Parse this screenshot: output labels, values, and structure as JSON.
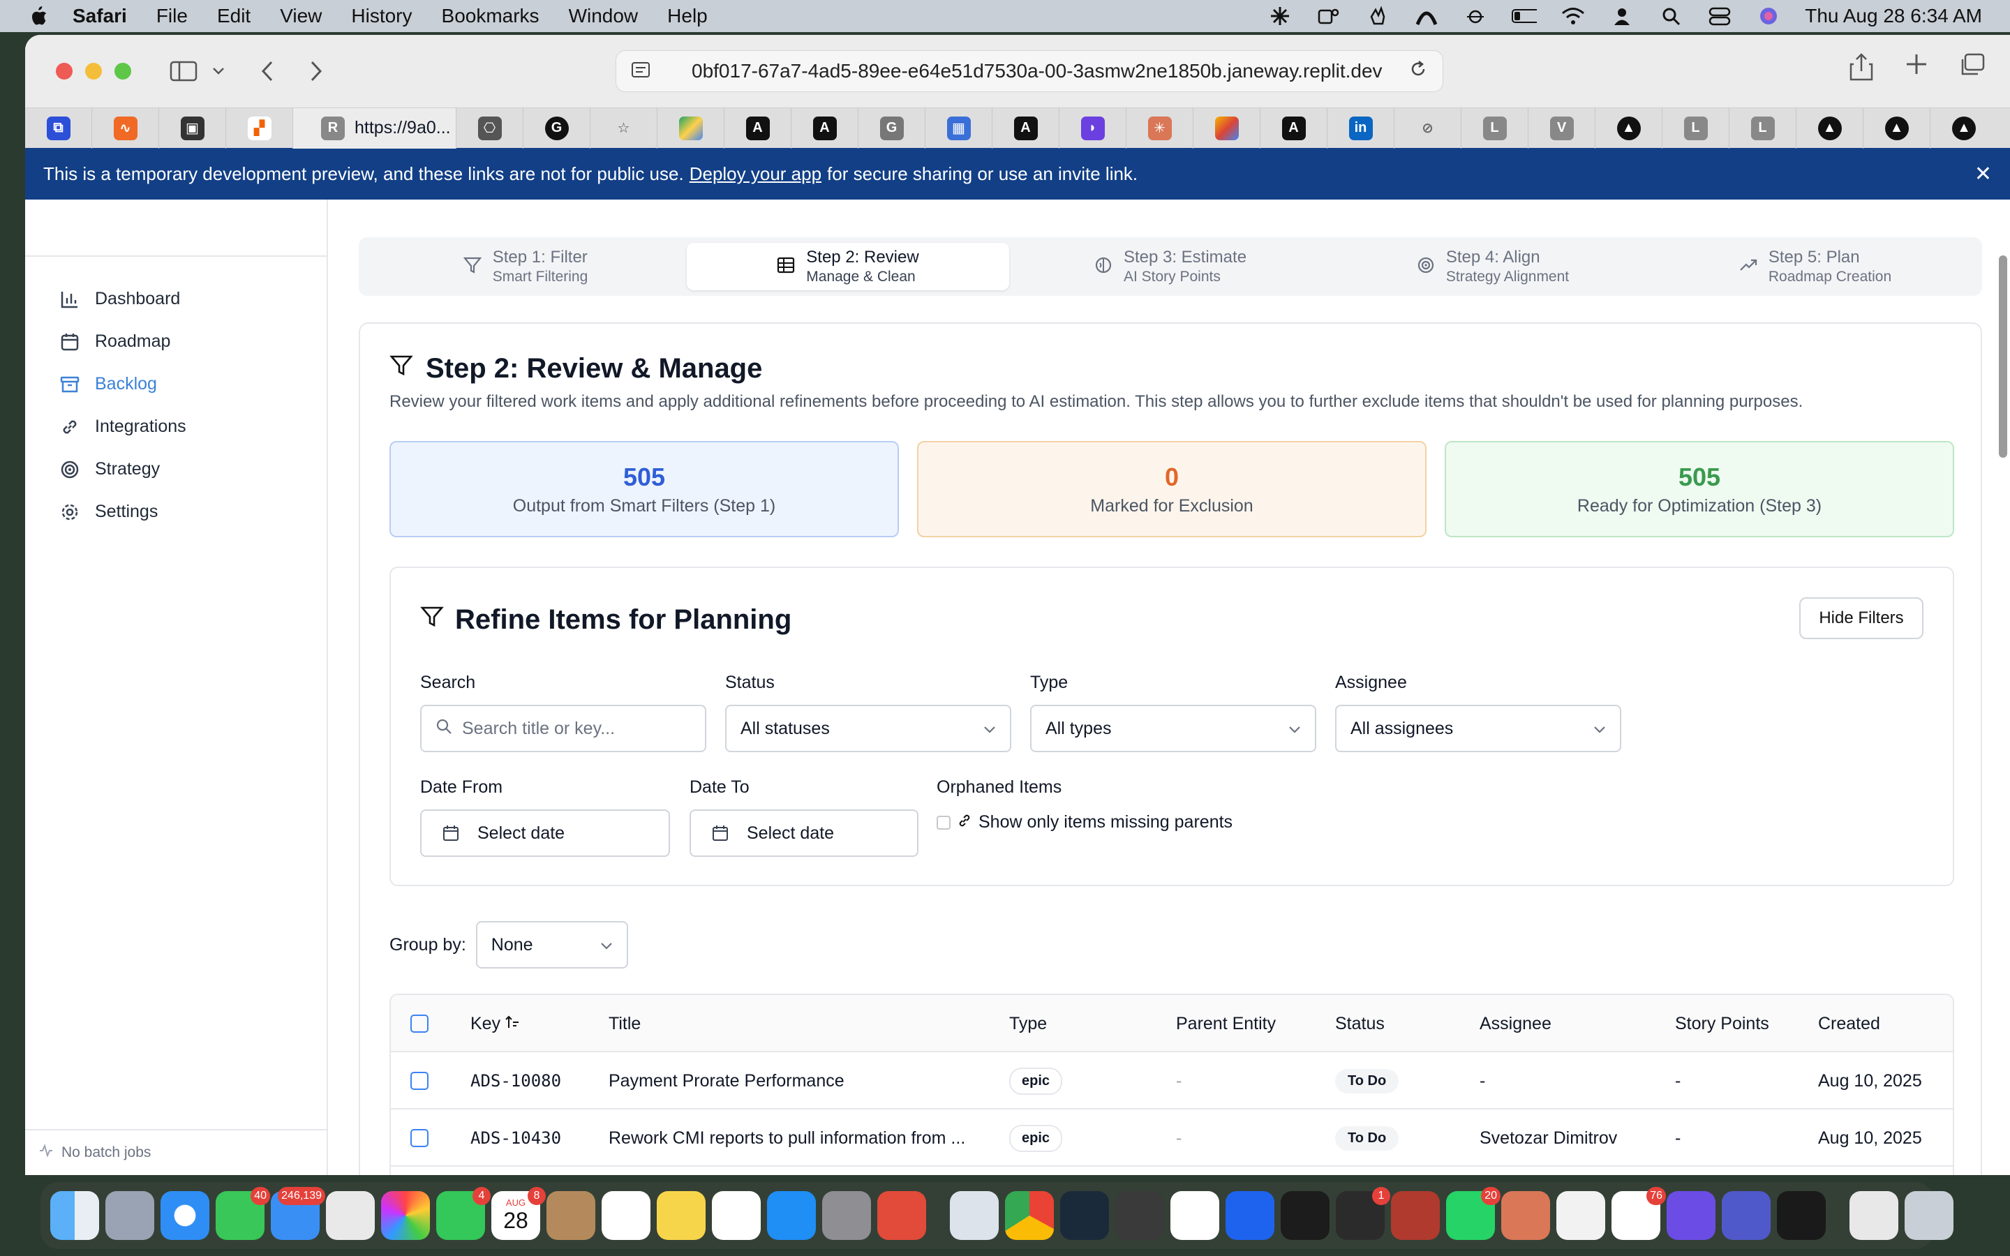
{
  "menubar": {
    "app": "Safari",
    "items": [
      "File",
      "Edit",
      "View",
      "History",
      "Bookmarks",
      "Window",
      "Help"
    ],
    "clock": "Thu Aug 28  6:34 AM"
  },
  "browser": {
    "url": "0bf017-67a7-4ad5-89ee-e64e51d7530a-00-3asmw2ne1850b.janeway.replit.dev",
    "active_tab": "https://9a0...",
    "active_tab_letter": "R"
  },
  "banner": {
    "text_before": "This is a temporary development preview, and these links are not for public use.",
    "link": "Deploy your app",
    "text_after": "for secure sharing or use an invite link."
  },
  "sidebar": {
    "items": [
      {
        "label": "Dashboard",
        "icon": "bar-chart-icon"
      },
      {
        "label": "Roadmap",
        "icon": "calendar-icon"
      },
      {
        "label": "Backlog",
        "icon": "archive-icon"
      },
      {
        "label": "Integrations",
        "icon": "link-icon"
      },
      {
        "label": "Strategy",
        "icon": "target-icon"
      },
      {
        "label": "Settings",
        "icon": "gear-icon"
      }
    ],
    "active": "Backlog",
    "footer": "No batch jobs"
  },
  "steps": [
    {
      "title": "Step 1: Filter",
      "sub": "Smart Filtering",
      "icon": "filter-icon"
    },
    {
      "title": "Step 2: Review",
      "sub": "Manage & Clean",
      "icon": "table-icon"
    },
    {
      "title": "Step 3: Estimate",
      "sub": "AI Story Points",
      "icon": "brain-icon"
    },
    {
      "title": "Step 4: Align",
      "sub": "Strategy Alignment",
      "icon": "target-icon"
    },
    {
      "title": "Step 5: Plan",
      "sub": "Roadmap Creation",
      "icon": "trend-icon"
    }
  ],
  "review": {
    "title": "Step 2: Review & Manage",
    "description": "Review your filtered work items and apply additional refinements before proceeding to AI estimation. This step allows you to further exclude items that shouldn't be used for planning purposes.",
    "stats": [
      {
        "value": "505",
        "label": "Output from Smart Filters (Step 1)",
        "color": "#2f5fd6"
      },
      {
        "value": "0",
        "label": "Marked for Exclusion",
        "color": "#e0682b"
      },
      {
        "value": "505",
        "label": "Ready for Optimization (Step 3)",
        "color": "#3a9a4e"
      }
    ]
  },
  "refine": {
    "title": "Refine Items for Planning",
    "hide_button": "Hide Filters",
    "search_label": "Search",
    "search_placeholder": "Search title or key...",
    "status_label": "Status",
    "status_value": "All statuses",
    "type_label": "Type",
    "type_value": "All types",
    "assignee_label": "Assignee",
    "assignee_value": "All assignees",
    "date_from_label": "Date From",
    "date_from_value": "Select date",
    "date_to_label": "Date To",
    "date_to_value": "Select date",
    "orphaned_label": "Orphaned Items",
    "orphaned_option": "Show only items missing parents"
  },
  "groupby": {
    "label": "Group by:",
    "value": "None"
  },
  "table": {
    "columns": [
      "Key",
      "Title",
      "Type",
      "Parent Entity",
      "Status",
      "Assignee",
      "Story Points",
      "Created"
    ],
    "rows": [
      {
        "key": "ADS-10080",
        "title": "Payment Prorate Performance",
        "type": "epic",
        "parent": "-",
        "status": "To Do",
        "assignee": "-",
        "points": "-",
        "created": "Aug 10, 2025"
      },
      {
        "key": "ADS-10430",
        "title": "Rework CMI reports to pull information from ...",
        "type": "epic",
        "parent": "-",
        "status": "To Do",
        "assignee": "Svetozar Dimitrov",
        "points": "-",
        "created": "Aug 10, 2025"
      }
    ]
  },
  "dock": {
    "badges": {
      "messages": "40",
      "mail": "246,139",
      "facetime": "4",
      "calendar_month": "AUG",
      "calendar_day": "28",
      "calendar_badge": "8",
      "terminal": "1",
      "whatsapp": "20",
      "slack": "76"
    }
  }
}
